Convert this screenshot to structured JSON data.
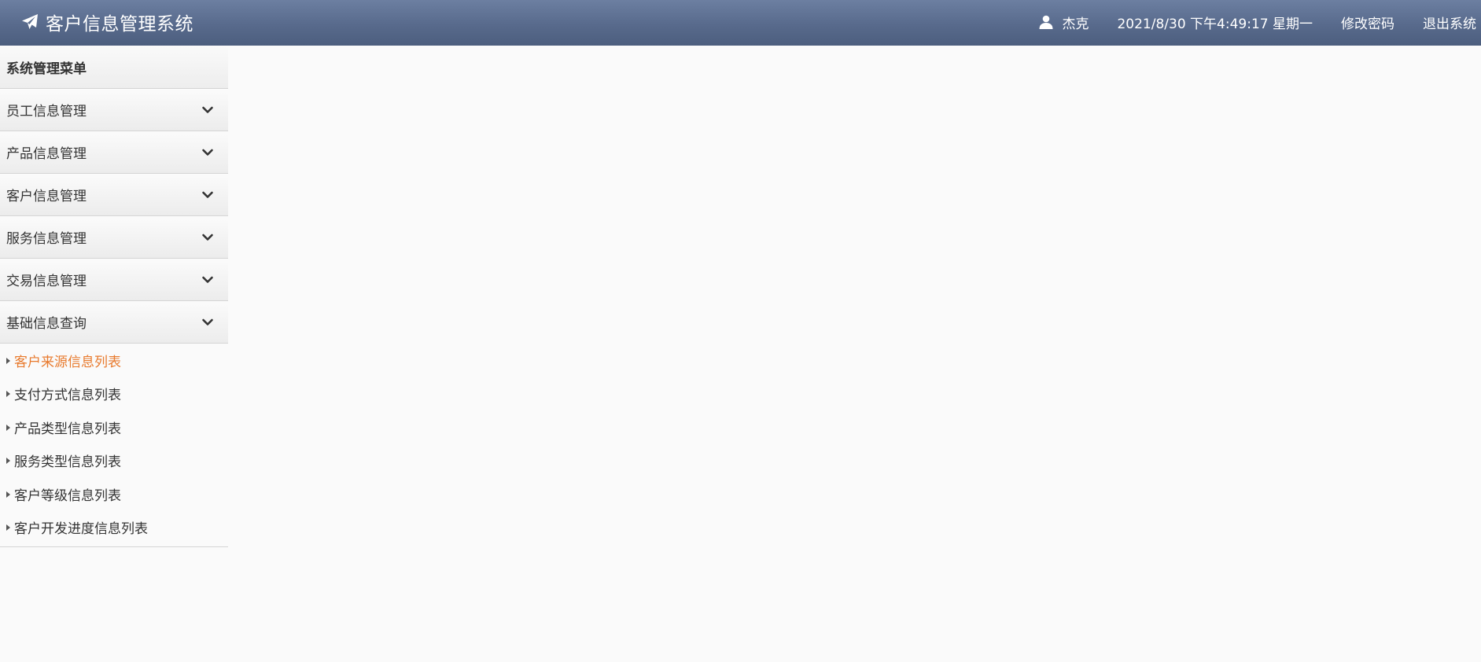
{
  "header": {
    "title": "客户信息管理系统",
    "brand_icon": "paper-plane-icon",
    "user_icon": "user-icon",
    "username": "杰克",
    "datetime": "2021/8/30 下午4:49:17 星期一",
    "change_password": "修改密码",
    "logout": "退出系统"
  },
  "sidebar": {
    "title": "系统管理菜单",
    "chevron_icon": "chevron-down-icon",
    "groups": [
      {
        "label": "员工信息管理"
      },
      {
        "label": "产品信息管理"
      },
      {
        "label": "客户信息管理"
      },
      {
        "label": "服务信息管理"
      },
      {
        "label": "交易信息管理"
      },
      {
        "label": "基础信息查询",
        "expanded": true
      }
    ],
    "sub_items": [
      {
        "label": "客户来源信息列表",
        "active": true
      },
      {
        "label": "支付方式信息列表"
      },
      {
        "label": "产品类型信息列表"
      },
      {
        "label": "服务类型信息列表"
      },
      {
        "label": "客户等级信息列表"
      },
      {
        "label": "客户开发进度信息列表"
      }
    ]
  },
  "colors": {
    "header_top": "#6c7fa1",
    "header_bottom": "#4c5e7e",
    "active_item": "#e87a2d",
    "background": "#fafafa",
    "border": "#d4d4d4"
  }
}
